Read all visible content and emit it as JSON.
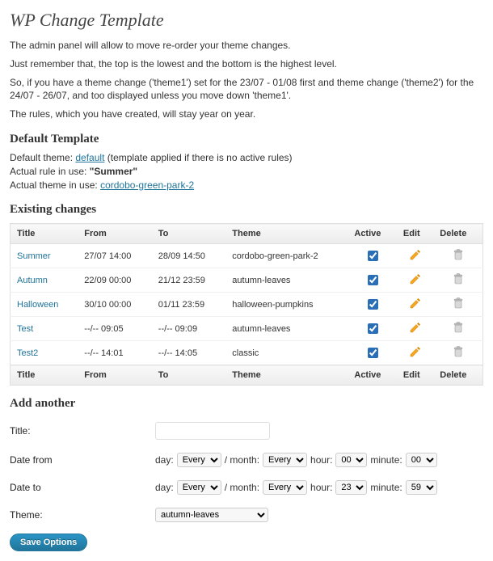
{
  "page_title": "WP Change Template",
  "intro": {
    "line1": "The admin panel will allow to move re-order your theme changes.",
    "line2": "Just remember that, the top is the lowest and the bottom is the highest level.",
    "line3": "So, if you have a theme change ('theme1') set for the 23/07 - 01/08 first and theme change ('theme2') for the 24/07 - 26/07, and too displayed unless you move down 'theme1'.",
    "line4": "The rules, which you have created, will stay year on year."
  },
  "default_template": {
    "heading": "Default Template",
    "default_label": "Default theme: ",
    "default_link": "default",
    "default_suffix": " (template applied if there is no active rules)",
    "rule_label": "Actual rule in use: ",
    "rule_value": "\"Summer\"",
    "theme_label": "Actual theme in use: ",
    "theme_link": "cordobo-green-park-2"
  },
  "existing": {
    "heading": "Existing changes",
    "headers": {
      "title": "Title",
      "from": "From",
      "to": "To",
      "theme": "Theme",
      "active": "Active",
      "edit": "Edit",
      "delete": "Delete"
    },
    "rows": [
      {
        "title": "Summer",
        "from": "27/07 14:00",
        "to": "28/09 14:50",
        "theme": "cordobo-green-park-2",
        "active": true
      },
      {
        "title": "Autumn",
        "from": "22/09 00:00",
        "to": "21/12 23:59",
        "theme": "autumn-leaves",
        "active": true
      },
      {
        "title": "Halloween",
        "from": "30/10 00:00",
        "to": "01/11 23:59",
        "theme": "halloween-pumpkins",
        "active": true
      },
      {
        "title": "Test",
        "from": "--/-- 09:05",
        "to": "--/-- 09:09",
        "theme": "autumn-leaves",
        "active": true
      },
      {
        "title": "Test2",
        "from": "--/-- 14:01",
        "to": "--/-- 14:05",
        "theme": "classic",
        "active": true
      }
    ]
  },
  "add": {
    "heading": "Add another",
    "title_label": "Title:",
    "date_from_label": "Date from",
    "date_to_label": "Date to",
    "theme_label": "Theme:",
    "day_label": "day: ",
    "month_label": " / month: ",
    "hour_label": " hour: ",
    "minute_label": " minute: ",
    "every": "Every",
    "from_hour": "00",
    "from_minute": "00",
    "to_hour": "23",
    "to_minute": "59",
    "theme_value": "autumn-leaves",
    "save_label": "Save Options"
  }
}
